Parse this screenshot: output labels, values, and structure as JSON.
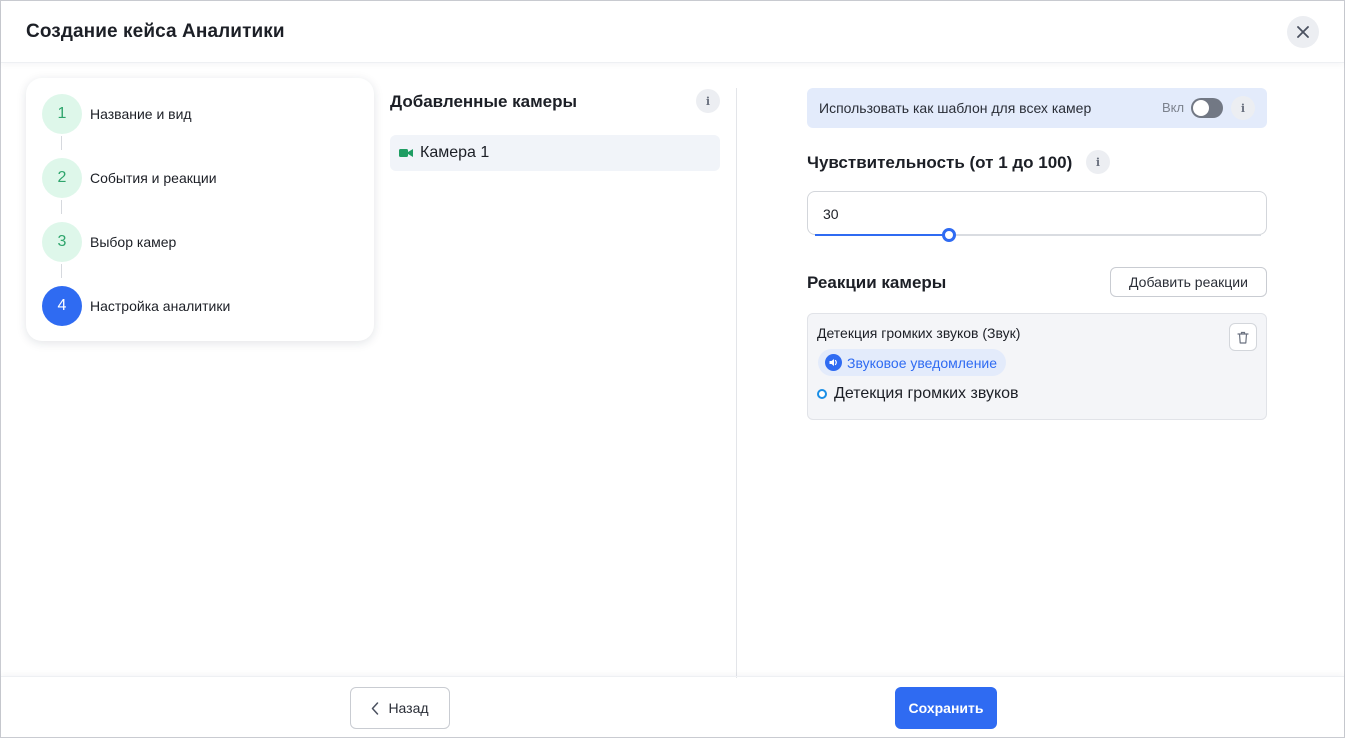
{
  "header": {
    "title": "Создание кейса Аналитики"
  },
  "stepper": {
    "steps": [
      {
        "number": "1",
        "label": "Название и вид",
        "state": "done"
      },
      {
        "number": "2",
        "label": "События и реакции",
        "state": "done"
      },
      {
        "number": "3",
        "label": "Выбор камер",
        "state": "done"
      },
      {
        "number": "4",
        "label": "Настройка аналитики",
        "state": "active"
      }
    ]
  },
  "cameras": {
    "title": "Добавленные камеры",
    "info_icon": "i",
    "items": [
      {
        "label": "Камера 1",
        "icon": "video-camera-icon",
        "selected": true
      }
    ]
  },
  "settings": {
    "template": {
      "label": "Использовать как шаблон для всех камер",
      "toggle_label": "Вкл",
      "toggle_on": false,
      "info_icon": "i"
    },
    "sensitivity": {
      "title": "Чувствительность (от 1 до 100)",
      "info_icon": "i",
      "value": "30",
      "min": 1,
      "max": 100,
      "slider_fraction": 0.3
    },
    "reactions": {
      "title": "Реакции камеры",
      "add_button": "Добавить реакции",
      "items": [
        {
          "name": "Детекция громких звуков (Звук)",
          "chip_label": "Звуковое уведомление",
          "chip_icon": "speaker-icon",
          "event_label": "Детекция громких звуков"
        }
      ]
    }
  },
  "footer": {
    "back_label": "Назад",
    "save_label": "Сохранить"
  },
  "colors": {
    "accent": "#2f6bf2",
    "step_done_bg": "#def7ea",
    "step_done_text": "#2ea56c",
    "highlight_bg": "#e3ebfb",
    "camera_icon": "#1f9d63"
  }
}
